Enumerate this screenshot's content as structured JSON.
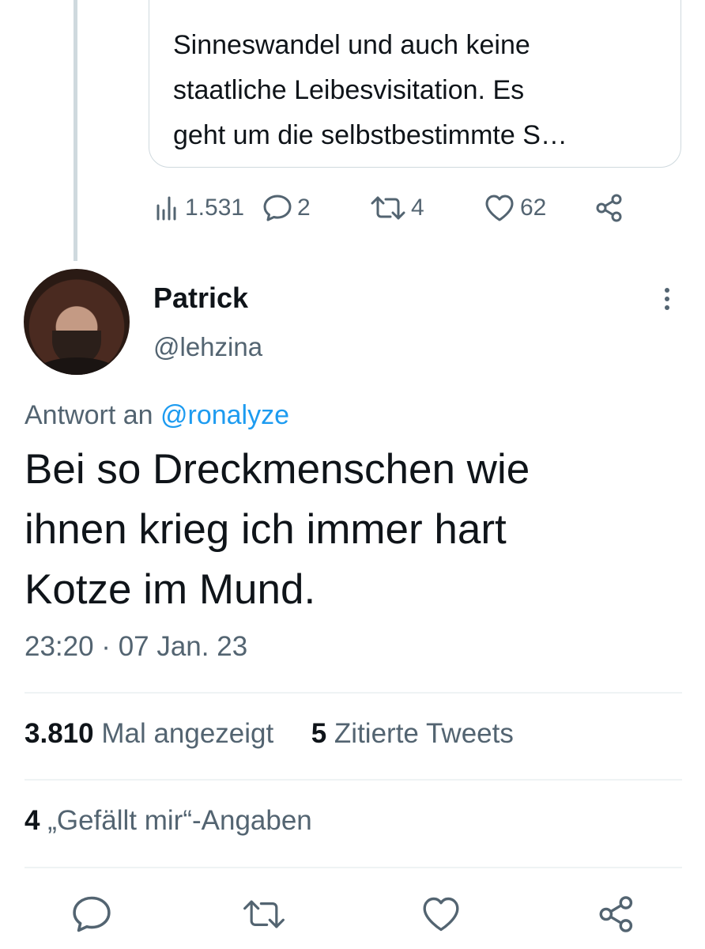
{
  "quoted_tweet": {
    "text": "Sinneswandel und auch keine\nstaatliche Leibesvisitation. Es\ngeht um die selbstbestimmte S…"
  },
  "quoted_metrics": {
    "views": "1.531",
    "replies": "2",
    "retweets": "4",
    "likes": "62"
  },
  "author": {
    "display_name": "Patrick",
    "handle": "@lehzina"
  },
  "reply": {
    "prefix": "Antwort an",
    "mention": "@ronalyze"
  },
  "tweet": {
    "text": "Bei so Dreckmenschen wie\nihnen krieg ich immer hart\nKotze im Mund.",
    "timestamp": "23:20 · 07 Jan. 23"
  },
  "stats": {
    "views_count": "3.810",
    "views_label": "Mal angezeigt",
    "quotes_count": "5",
    "quotes_label": "Zitierte Tweets",
    "likes_count": "4",
    "likes_label": "„Gefällt mir“-Angaben"
  },
  "colors": {
    "text_primary": "#0f1419",
    "text_secondary": "#536471",
    "link": "#1d9bf0",
    "border": "#cfd9de",
    "divider": "#eff3f4"
  },
  "icons": {
    "views": "bar-chart-icon",
    "reply": "speech-bubble-icon",
    "retweet": "retweet-arrows-icon",
    "like": "heart-icon",
    "share": "share-nodes-icon",
    "more": "vertical-ellipsis-icon"
  }
}
